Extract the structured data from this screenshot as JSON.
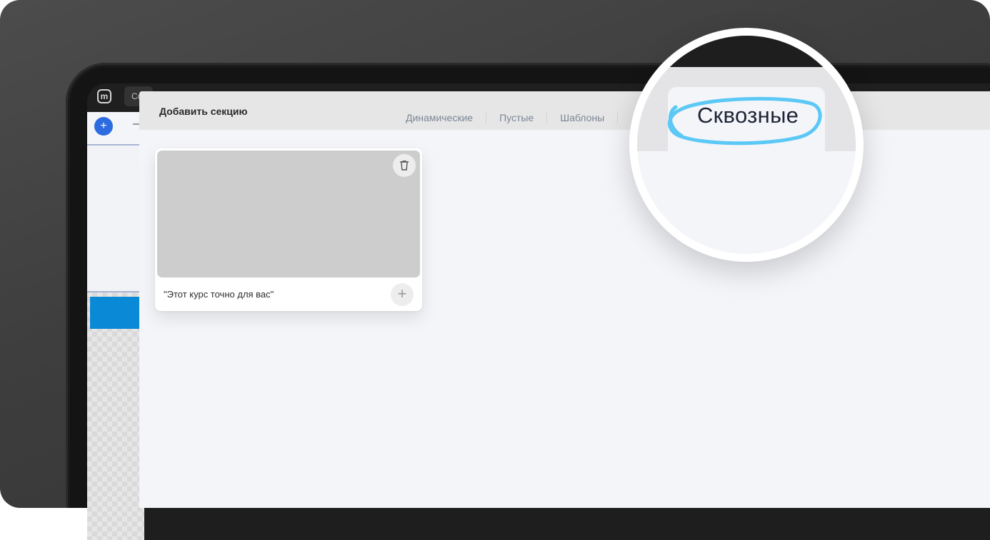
{
  "app": {
    "logo_letter": "m",
    "topbar_tab_label": "Co",
    "add_icon": "plus-icon"
  },
  "modal": {
    "title": "Добавить секцию",
    "tabs": [
      {
        "label": "Динамические"
      },
      {
        "label": "Пустые"
      },
      {
        "label": "Шаблоны"
      }
    ],
    "active_tab_zoomed": "Сквозные"
  },
  "cards": [
    {
      "title": "\"Этот курс точно для вас\"",
      "delete_icon": "trash-icon",
      "add_icon": "plus-icon"
    }
  ],
  "colors": {
    "accent_blue": "#2d6cdf",
    "highlight_ring": "#5bc8f5",
    "section_blue": "#0a8ad6"
  }
}
